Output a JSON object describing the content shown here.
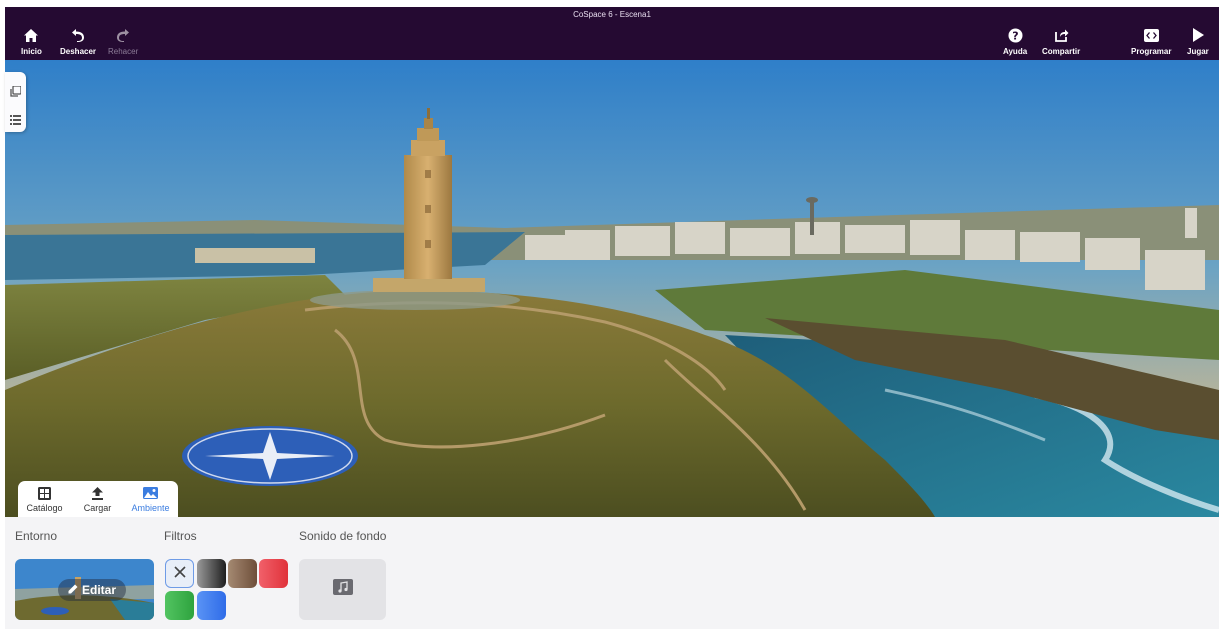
{
  "app": {
    "title": "CoSpace 6 - Escena1"
  },
  "toolbar": {
    "home_label": "Inicio",
    "undo_label": "Deshacer",
    "redo_label": "Rehacer",
    "help_label": "Ayuda",
    "share_label": "Compartir",
    "code_label": "Programar",
    "play_label": "Jugar"
  },
  "tabs": [
    {
      "label": "Catálogo",
      "icon": "grid-icon",
      "active": false
    },
    {
      "label": "Cargar",
      "icon": "upload-icon",
      "active": false
    },
    {
      "label": "Ambiente",
      "icon": "landscape-icon",
      "active": true
    }
  ],
  "bottom_panel": {
    "environment_label": "Entorno",
    "edit_label": "Editar",
    "filters_label": "Filtros",
    "sound_label": "Sonido de fondo",
    "filters": [
      {
        "name": "none",
        "color": "#e8eef8"
      },
      {
        "name": "black-white",
        "color": "#3a3a3a"
      },
      {
        "name": "sepia",
        "color": "#8a6a55"
      },
      {
        "name": "red",
        "color": "#e8454d"
      },
      {
        "name": "green",
        "color": "#3bb54a"
      },
      {
        "name": "blue",
        "color": "#3d7bf0"
      }
    ]
  },
  "colors": {
    "topbar": "#250a32",
    "accent": "#3b7de0",
    "panel": "#f4f4f6"
  }
}
